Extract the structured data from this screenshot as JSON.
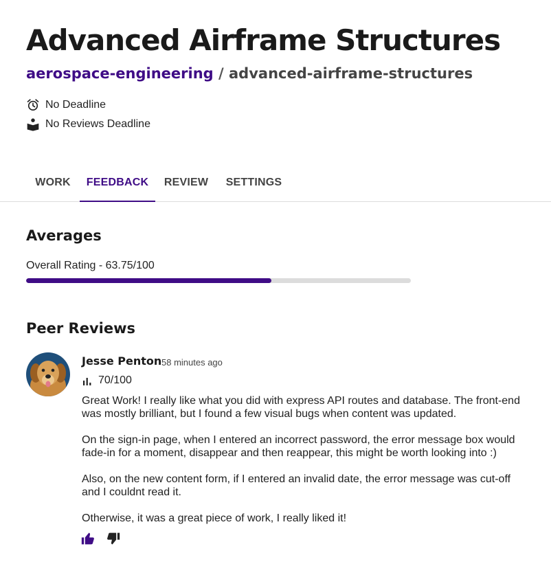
{
  "header": {
    "title": "Advanced Airframe Structures",
    "breadcrumb": {
      "org": "aerospace-engineering",
      "separator": " / ",
      "repo": "advanced-airframe-structures"
    },
    "meta": [
      {
        "icon": "alarm-clock-icon",
        "text": "No Deadline"
      },
      {
        "icon": "reader-icon",
        "text": "No Reviews Deadline"
      }
    ]
  },
  "tabs": [
    {
      "label": "WORK",
      "active": false
    },
    {
      "label": "FEEDBACK",
      "active": true
    },
    {
      "label": "REVIEW",
      "active": false
    },
    {
      "label": "SETTINGS",
      "active": false
    }
  ],
  "averages": {
    "heading": "Averages",
    "overall_label": "Overall Rating - 63.75/100",
    "overall_value": 63.75,
    "overall_max": 100
  },
  "peer_reviews": {
    "heading": "Peer Reviews",
    "items": [
      {
        "author": "Jesse Penton",
        "time": "58 minutes ago",
        "score": "70/100",
        "paragraphs": [
          "Great Work! I really like what you did with express API routes and database. The front-end was mostly brilliant, but I found a few visual bugs when content was updated.",
          "On the sign-in page, when I entered an incorrect password, the error message box would fade-in for a moment, disappear and then reappear, this might be worth looking into :)",
          "Also, on the new content form, if I entered an invalid date, the error message was cut-off and I couldnt read it.",
          "Otherwise, it was a great piece of work, I really liked it!"
        ]
      }
    ]
  },
  "colors": {
    "accent": "#3f0c86",
    "track": "#dcdcdc",
    "text": "#222222"
  }
}
